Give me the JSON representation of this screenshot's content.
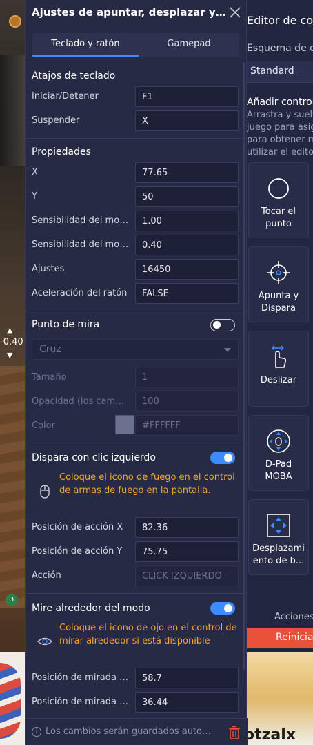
{
  "dialog": {
    "title": "Ajustes de apuntar, desplazar y d...",
    "tabs": [
      {
        "label": "Teclado y ratón",
        "active": true
      },
      {
        "label": "Gamepad",
        "active": false
      }
    ]
  },
  "shortcuts": {
    "title": "Atajos de teclado",
    "rows": [
      {
        "label": "Iniciar/Detener",
        "value": "F1"
      },
      {
        "label": "Suspender",
        "value": "X"
      }
    ]
  },
  "properties": {
    "title": "Propiedades",
    "rows": [
      {
        "label": "X",
        "value": "77.65"
      },
      {
        "label": "Y",
        "value": "50"
      },
      {
        "label": "Sensibilidad del mou...",
        "value": "1.00"
      },
      {
        "label": "Sensibilidad del mou...",
        "value": "0.40"
      },
      {
        "label": "Ajustes",
        "value": "16450"
      },
      {
        "label": "Aceleración del ratón",
        "value": "FALSE"
      }
    ]
  },
  "crosshair": {
    "title": "Punto de mira",
    "toggle_on": false,
    "select_value": "Cruz",
    "rows": [
      {
        "label": "Tamaño",
        "value": "1"
      },
      {
        "label": "Opacidad (los cambio...",
        "value": "100"
      },
      {
        "label": "Color",
        "value": "#FFFFFF"
      }
    ],
    "swatch_color": "#6d7190"
  },
  "left_click_fire": {
    "title": "Dispara con clic izquierdo",
    "toggle_on": true,
    "hint": "Coloque el icono de fuego en el control de armas de fuego en la pantalla.",
    "rows": [
      {
        "label": "Posición de acción X",
        "value": "82.36"
      },
      {
        "label": "Posición de acción Y",
        "value": "75.75"
      },
      {
        "label": "Acción",
        "value": "CLICK IZQUIERDO"
      }
    ]
  },
  "look_around": {
    "title": "Mire alrededor del modo",
    "toggle_on": true,
    "hint": "Coloque el icono de ojo en el control de mirar alrededor si está disponible",
    "rows": [
      {
        "label": "Posición de mirada li...",
        "value": "58.7"
      },
      {
        "label": "Posición de mirada li...",
        "value": "36.44"
      }
    ]
  },
  "footer": {
    "text": "Los cambios serán guardados autom..."
  },
  "right_panel": {
    "title": "Editor de con",
    "scheme_label": "Esquema de co",
    "scheme_value": "Standard",
    "add_controls": "Añadir controle",
    "description_lines": [
      "Arrastra y suelta",
      "juego para asign",
      "para obtener má",
      "utilizar el editor"
    ],
    "cards": [
      {
        "label": "Tocar el punto",
        "icon": "circle-icon"
      },
      {
        "label": "Apunta y Dispara",
        "icon": "crosshair-icon"
      },
      {
        "label": "Deslizar",
        "icon": "swipe-hand-icon"
      },
      {
        "label": "D-Pad MOBA",
        "icon": "dpad-icon"
      },
      {
        "label": "Desplazamiento de b...",
        "icon": "pan-arrows-icon"
      }
    ],
    "actions_label": "Acciones",
    "reset_label": "Reinicia",
    "bottom_text": "otzalx"
  },
  "game": {
    "value_readout": "-0.40",
    "badge": "3"
  },
  "colors": {
    "accent": "#3d8bff",
    "hint": "#f4a52e",
    "dialog_bg": "#262a44",
    "reset": "#e8503a"
  }
}
